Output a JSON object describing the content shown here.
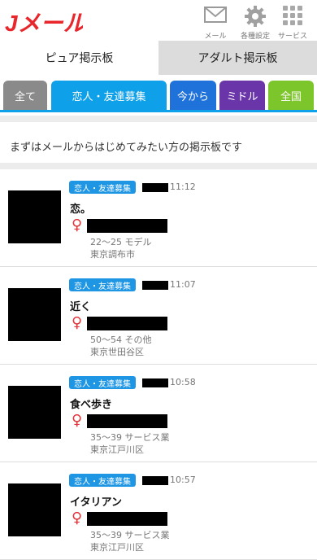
{
  "header": {
    "logo_text": "Jメール",
    "icons": [
      {
        "label": "メール",
        "icon": "mail-icon"
      },
      {
        "label": "各種設定",
        "icon": "gear-icon"
      },
      {
        "label": "サービス",
        "icon": "grid-icon"
      }
    ]
  },
  "board_tabs": [
    "ピュア掲示板",
    "アダルト掲示板"
  ],
  "categories": [
    {
      "label": "全て",
      "color": "#8a8a8a"
    },
    {
      "label": "恋人・友達募集",
      "color": "#0fa0ea"
    },
    {
      "label": "今から",
      "color": "#1f72d9"
    },
    {
      "label": "ミドル",
      "color": "#6a35a8"
    },
    {
      "label": "全国",
      "color": "#7cc52a"
    }
  ],
  "notice": "まずはメールからはじめてみたい方の掲示板です",
  "colors": {
    "accent": "#0fa0ea",
    "female": "#e0353a",
    "logo": "#e8262c"
  },
  "posts": [
    {
      "badge": "恋人・友達募集",
      "time": "11:12",
      "title": "恋。",
      "gender_icon": "female-icon",
      "gender": "♀",
      "age_job": "22～25 モデル",
      "location": "東京調布市"
    },
    {
      "badge": "恋人・友達募集",
      "time": "11:07",
      "title": "近く",
      "gender_icon": "female-icon",
      "gender": "♀",
      "age_job": "50～54 その他",
      "location": "東京世田谷区"
    },
    {
      "badge": "恋人・友達募集",
      "time": "10:58",
      "title": "食べ歩き",
      "gender_icon": "female-icon",
      "gender": "♀",
      "age_job": "35～39 サービス業",
      "location": "東京江戸川区"
    },
    {
      "badge": "恋人・友達募集",
      "time": "10:57",
      "title": "イタリアン",
      "gender_icon": "female-icon",
      "gender": "♀",
      "age_job": "35～39 サービス業",
      "location": "東京江戸川区"
    }
  ]
}
